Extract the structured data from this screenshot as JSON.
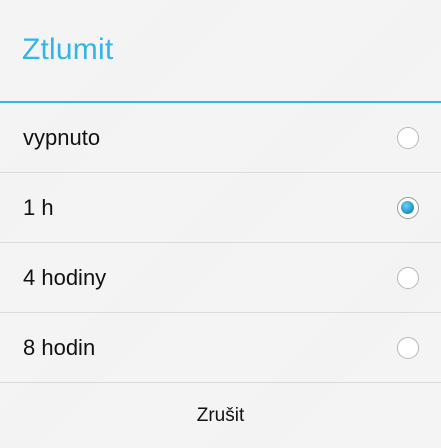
{
  "dialog": {
    "title": "Ztlumit",
    "accent_color": "#33b5e5",
    "options": [
      {
        "label": "vypnuto",
        "selected": false
      },
      {
        "label": "1 h",
        "selected": true
      },
      {
        "label": "4 hodiny",
        "selected": false
      },
      {
        "label": "8 hodin",
        "selected": false
      }
    ],
    "cancel_label": "Zrušit"
  }
}
